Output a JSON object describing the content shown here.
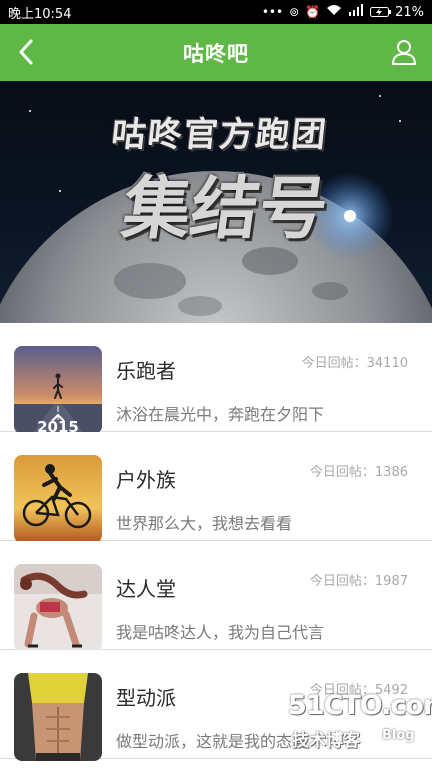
{
  "status_bar": {
    "time": "晚上10:54",
    "battery": "21%",
    "icons": [
      "dots-icon",
      "data-sync-icon",
      "alarm-icon",
      "wifi-icon",
      "signal-icon",
      "charging-icon"
    ]
  },
  "app_bar": {
    "title": "咕咚吧",
    "left_icon": "back-chevron-icon",
    "right_icon": "user-profile-icon",
    "background": "#5fb846"
  },
  "banner": {
    "line1": "咕咚官方跑团",
    "line2": "集结号"
  },
  "groups": [
    {
      "title": "乐跑者",
      "count_label": "今日回帖：34110",
      "desc": "沐浴在晨光中，奔跑在夕阳下",
      "thumb": "runner-road-2015"
    },
    {
      "title": "户外族",
      "count_label": "今日回帖：1386",
      "desc": "世界那么大，我想去看看",
      "thumb": "cyclist-silhouette-sunset"
    },
    {
      "title": "达人堂",
      "count_label": "今日回帖：1987",
      "desc": "我是咕咚达人，我为自己代言",
      "thumb": "fitness-woman-stretch"
    },
    {
      "title": "型动派",
      "count_label": "今日回帖：5492",
      "desc": "做型动派，这就是我的态度",
      "thumb": "abs-workout-woman"
    }
  ],
  "watermark": {
    "site": "51CTO.com",
    "sub": "技术博客",
    "blog": "Blog"
  }
}
